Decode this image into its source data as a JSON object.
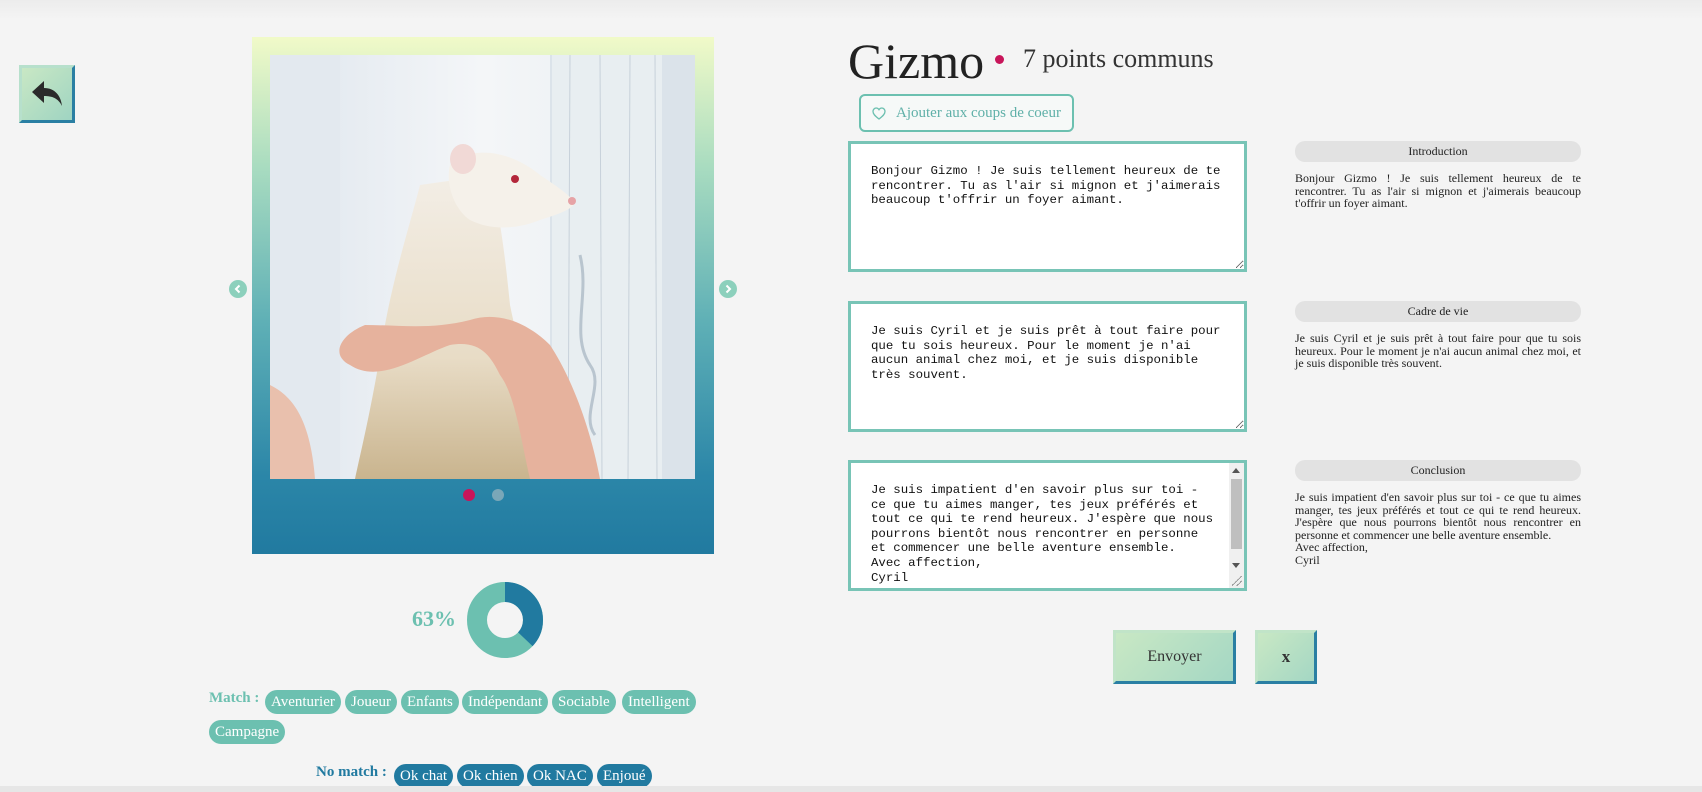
{
  "profile": {
    "name": "Gizmo",
    "common_points": "7 points communs",
    "favorite_label": "Ajouter aux coups de coeur",
    "photo_count": 2,
    "active_photo": 1,
    "match_percent": "63%",
    "match_fraction": 0.63
  },
  "messages": {
    "introduction": {
      "label": "Introduction",
      "text": "Bonjour Gizmo ! Je suis tellement heureux de te rencontrer. Tu as l'air si mignon et j'aimerais beaucoup t'offrir un foyer aimant."
    },
    "cadre": {
      "label": "Cadre de vie",
      "text": "Je suis Cyril et je suis prêt à tout faire pour que tu sois heureux. Pour le moment je n'ai aucun animal chez moi, et je suis disponible très souvent."
    },
    "conclusion": {
      "label": "Conclusion",
      "text": "Je suis impatient d'en savoir plus sur toi - ce que tu aimes manger, tes jeux préférés et tout ce qui te rend heureux. J'espère que nous pourrons bientôt nous rencontrer en personne et commencer une belle aventure ensemble.\nAvec affection,\nCyril"
    }
  },
  "tags": {
    "match_label": "Match :",
    "match": [
      "Aventurier",
      "Joueur",
      "Enfants",
      "Indépendant",
      "Sociable",
      "Intelligent",
      "Campagne"
    ],
    "nomatch_label": "No match :",
    "nomatch": [
      "Ok chat",
      "Ok chien",
      "Ok NAC",
      "Enjoué"
    ]
  },
  "actions": {
    "send_label": "Envoyer",
    "close_label": "x"
  },
  "colors": {
    "accent_teal": "#6cc0b0",
    "accent_blue": "#217aa0",
    "accent_red": "#c8155a"
  },
  "icons": {
    "back": "back-arrow-icon",
    "favorite": "heart-icon",
    "prev": "chevron-left-icon",
    "next": "chevron-right-icon"
  }
}
